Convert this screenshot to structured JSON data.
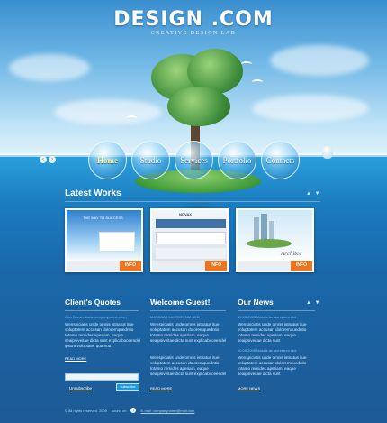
{
  "logo": {
    "title": "DESIGN .COM",
    "tagline": "CREATIVE DESIGN LAB"
  },
  "nav": {
    "prev_arrow": "‹",
    "next_arrow": "›",
    "items": [
      {
        "label": "Home",
        "active": true
      },
      {
        "label": "Studio",
        "active": false
      },
      {
        "label": "Services",
        "active": false
      },
      {
        "label": "Portfolio",
        "active": false
      },
      {
        "label": "Contacts",
        "active": false
      }
    ]
  },
  "latest_works": {
    "title": "Latest Works",
    "dash": "▲ ▼",
    "items": [
      {
        "info_label": "INFO",
        "caption": "THE WAY TO SUCCESS"
      },
      {
        "info_label": "INFO",
        "caption": "NOVAX"
      },
      {
        "info_label": "INFO",
        "caption": "Architec"
      }
    ]
  },
  "quotes": {
    "title": "Client's Quotes",
    "byline": "Alan Brown (www.companyname.com)",
    "text": "Wenspiciatis unde omnis istnatus itue voluptatem accusan doloremquedntio totamo remides aperiam, eaque seaipsiveitae dicta sunt explicaboceendel ipsum voluptatet quamod",
    "read_more": "READ MORE",
    "subscribe_label": "subscribe",
    "unsubscribe_label": "Unsubscribe"
  },
  "welcome": {
    "title": "Welcome Guest!",
    "subtitle": "MASSAAS LAOREETUM SED",
    "text1": "Wenspiciatis unde omnis istnatus itue voluptatem accusan doloremquedntio totamo remides aperiam, eaque seaipsiveitae dicta sunt explicaboceendel",
    "text2": "Wenspiciatis unde omnis istnatus itue voluptatem accusan doloremquedntio totamo remides aperiam, eaque seaipsiveitae dicta sunt explicaboceendel",
    "read_more": "READ MORE"
  },
  "news": {
    "title": "Our News",
    "dash": "▲ ▼",
    "items": [
      {
        "date": "10.05.2009 Massis as laoreetum sed",
        "text": "Wenspiciatis unde omnis istnatus itue voluptatem accusan doloremquedntio totamo remides aperiam, eaque seaipsiveitae dicta sunt"
      },
      {
        "date": "10.09.2009 Massis as laoreetum sed",
        "text": "Wenspiciatis unde omnis istnatus itue voluptatem accusan doloremquedntio totamo remides aperiam, eaque seaipsiveitae dicta sunt"
      }
    ],
    "more_news": "MORE NEWS"
  },
  "footer": {
    "copyright": "© All rights reserved, 2009",
    "sound_label": "sound on",
    "email": "E-mail: companyname@mail.com"
  },
  "colors": {
    "accent": "#f0741e",
    "link": "#7cc7f0",
    "sea": "#1d5a95"
  }
}
